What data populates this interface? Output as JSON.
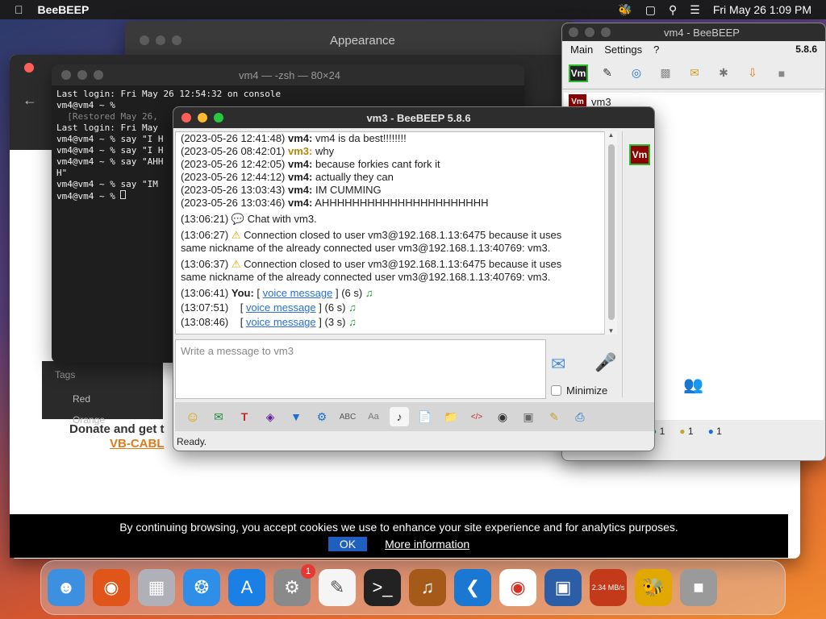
{
  "menubar": {
    "app_name": "BeeBEEP",
    "datetime": "Fri May 26  1:09 PM"
  },
  "appearance_window": {
    "title": "Appearance"
  },
  "side_panel": {
    "header": "Tags",
    "items": [
      "Red",
      "Orange"
    ]
  },
  "browser": {
    "promo_line1": "Donate and get t",
    "promo_link": "VB-CABL",
    "cookie_text": "By continuing browsing, you accept cookies we use to enhance your site experience and for analytics purposes.",
    "ok_label": "OK",
    "more_label": "More information"
  },
  "terminal": {
    "title": "vm4 — -zsh — 80×24",
    "lines": [
      "Last login: Fri May 26 12:54:32 on console",
      "vm4@vm4 ~ %",
      "  [Restored May 26,",
      "Last login: Fri May",
      "vm4@vm4 ~ % say \"I H",
      "vm4@vm4 ~ % say \"I H",
      "vm4@vm4 ~ % say \"AHH",
      "H\"",
      "vm4@vm4 ~ % say \"IM",
      "vm4@vm4 ~ % "
    ]
  },
  "vm4_window": {
    "title": "vm4 - BeeBEEP",
    "menu": [
      "Main",
      "Settings",
      "?"
    ],
    "version": "5.8.6",
    "user_label": "vm3",
    "status_counts": [
      "1",
      "1",
      "1"
    ]
  },
  "vm3_window": {
    "title": "vm3 - BeeBEEP 5.8.6",
    "avatar": "Vm",
    "messages": [
      {
        "time": "(2023-05-26 12:41:48)",
        "nick": "vm4:",
        "text": " vm4 is da best!!!!!!!!"
      },
      {
        "time": "(2023-05-26 08:42:01)",
        "nick": "vm3:",
        "text": " why"
      },
      {
        "time": "(2023-05-26 12:42:05)",
        "nick": "vm4:",
        "text": " because forkies cant fork it"
      },
      {
        "time": "(2023-05-26 12:44:12)",
        "nick": "vm4:",
        "text": " actually they can"
      },
      {
        "time": "(2023-05-26 13:03:43)",
        "nick": "vm4:",
        "text": " IM CUMMING"
      },
      {
        "time": "(2023-05-26 13:03:46)",
        "nick": "vm4:",
        "text": " AHHHHHHHHHHHHHHHHHHHHHH"
      }
    ],
    "sys_chat": "(13:06:21)",
    "sys_chat_text": "Chat with vm3.",
    "sys_warn1_time": "(13:06:27)",
    "sys_warn1_a": "Connection closed to user vm3@192.168.1.13:6475 because it uses",
    "sys_warn1_b": "same nickname of the already connected user vm3@192.168.1.13:40769: vm3.",
    "sys_warn2_time": "(13:06:37)",
    "sys_warn2_a": "Connection closed to user vm3@192.168.1.13:6475 because it uses",
    "sys_warn2_b": "same nickname of the already connected user vm3@192.168.1.13:40769: vm3.",
    "voice": [
      {
        "time": "(13:06:41)",
        "who": "You:",
        "link": "voice message",
        "dur": "] (6 s)"
      },
      {
        "time": "(13:07:51)",
        "who": "",
        "link": "voice message",
        "dur": "] (6 s)"
      },
      {
        "time": "(13:08:46)",
        "who": "",
        "link": "voice message",
        "dur": "] (3 s)"
      }
    ],
    "input_placeholder": "Write a message to vm3",
    "minimize_label": "Minimize",
    "status": "Ready."
  },
  "dock": {
    "settings_badge": "1",
    "speed": "2.34 MB/s"
  }
}
